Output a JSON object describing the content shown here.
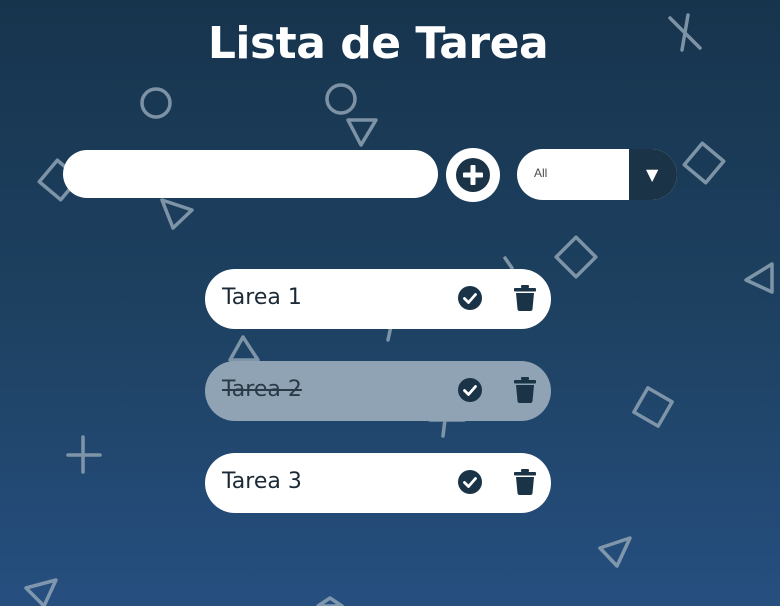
{
  "header": {
    "title": "Lista de Tarea"
  },
  "form": {
    "input_value": "",
    "input_placeholder": "",
    "add_icon": "plus-circle-icon",
    "filter": {
      "selected": "All",
      "arrow_glyph": "▼"
    }
  },
  "todos": [
    {
      "text": "Tarea 1",
      "completed": false
    },
    {
      "text": "Tarea 2",
      "completed": true
    },
    {
      "text": "Tarea 3",
      "completed": false
    }
  ],
  "colors": {
    "background_top": "#17344d",
    "background_bottom": "#264f80",
    "accent_dark": "#1a3346",
    "completed_item": "#8fa3b4",
    "shape_stroke": "#8fa3b4"
  }
}
